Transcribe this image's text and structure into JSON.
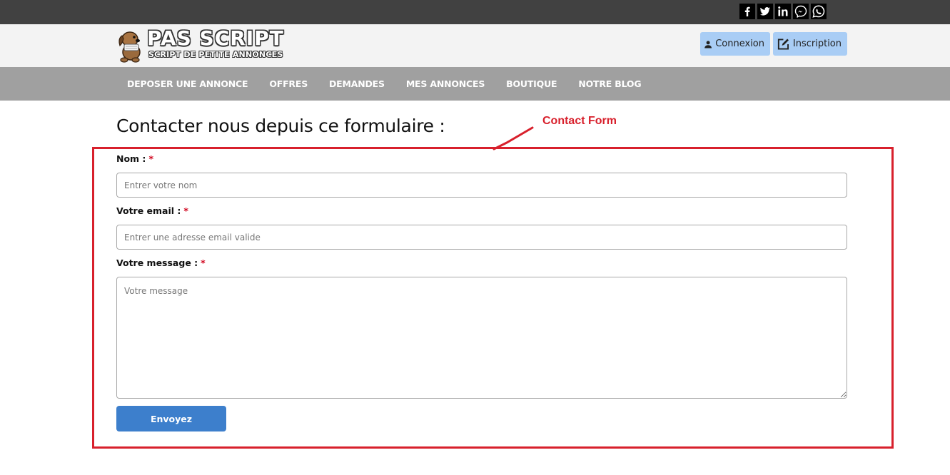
{
  "social": {
    "icons": [
      "facebook-icon",
      "twitter-icon",
      "linkedin-icon",
      "messenger-icon",
      "whatsapp-icon"
    ]
  },
  "brand": {
    "title": "PAS SCRIPT",
    "subtitle": "SCRIPT DE PETITE ANNONCES"
  },
  "auth": {
    "login_label": "Connexion",
    "signup_label": "Inscription"
  },
  "nav": {
    "items": [
      "DEPOSER UNE ANNONCE",
      "OFFRES",
      "DEMANDES",
      "MES ANNONCES",
      "BOUTIQUE",
      "NOTRE BLOG"
    ]
  },
  "page": {
    "title": "Contacter nous depuis ce formulaire :"
  },
  "annotation": {
    "label": "Contact Form",
    "color": "#d8202c"
  },
  "form": {
    "name_label": "Nom :",
    "name_placeholder": "Entrer votre nom",
    "email_label": "Votre email :",
    "email_placeholder": "Entrer une adresse email valide",
    "message_label": "Votre message :",
    "message_placeholder": "Votre message",
    "required_mark": "*",
    "submit_label": "Envoyez"
  },
  "colors": {
    "topbar": "#414141",
    "header": "#f3f3f3",
    "nav": "#a0a0a0",
    "auth_button": "#a9cdf5",
    "submit_button": "#3d7fcc",
    "required": "#d0021b"
  }
}
